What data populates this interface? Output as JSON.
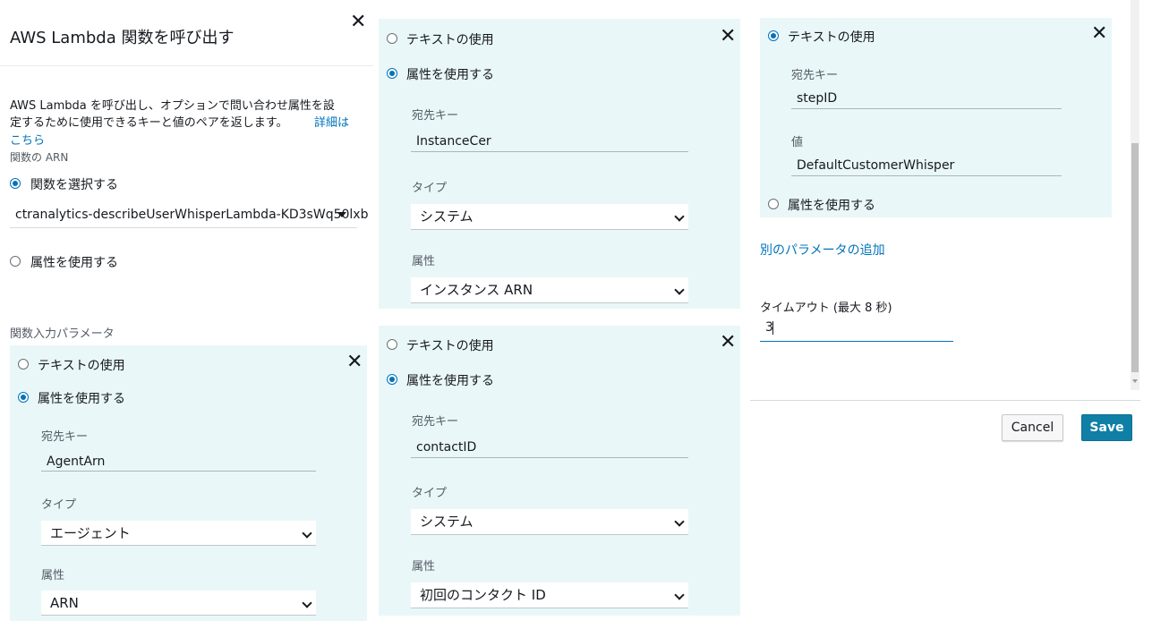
{
  "left": {
    "title": "AWS Lambda 関数を呼び出す",
    "description_line1": "AWS Lambda を呼び出し、オプションで問い合わせ属性を設",
    "description_line2": "定するために使用できるキーと値のペアを返します。",
    "learn_more_line1": "詳細は",
    "learn_more_line2": "こちら",
    "function_arn_label": "関数の ARN",
    "select_function_label": "関数を選択する",
    "function_value": "ctranalytics-describeUserWhisperLambda-KD3sWq50lxb",
    "use_attribute_label": "属性を使用する",
    "input_params_label": "関数入力パラメータ"
  },
  "panel1": {
    "use_text": "テキストの使用",
    "use_attribute": "属性を使用する",
    "dest_key_label": "宛先キー",
    "dest_key_value": "AgentArn",
    "type_label": "タイプ",
    "type_value": "エージェント",
    "attribute_label": "属性",
    "attribute_value": "ARN"
  },
  "panel2": {
    "use_text": "テキストの使用",
    "use_attribute": "属性を使用する",
    "dest_key_label": "宛先キー",
    "dest_key_value": "InstanceCer",
    "type_label": "タイプ",
    "type_value": "システム",
    "attribute_label": "属性",
    "attribute_value": "インスタンス ARN"
  },
  "panel3": {
    "use_text": "テキストの使用",
    "use_attribute": "属性を使用する",
    "dest_key_label": "宛先キー",
    "dest_key_value": "contactID",
    "type_label": "タイプ",
    "type_value": "システム",
    "attribute_label": "属性",
    "attribute_value": "初回のコンタクト ID"
  },
  "panel4": {
    "use_text": "テキストの使用",
    "dest_key_label": "宛先キー",
    "dest_key_value": "stepID",
    "value_label": "値",
    "value_value": "DefaultCustomerWhisper",
    "use_attribute": "属性を使用する"
  },
  "right": {
    "add_param_link": "別のパラメータの追加",
    "timeout_label": "タイムアウト (最大 8 秒)",
    "timeout_value": "3"
  },
  "footer": {
    "cancel_label": "Cancel",
    "save_label": "Save"
  },
  "colors": {
    "panel_bg": "#e9f7f8",
    "link": "#0073bb",
    "save_bg": "#0f7fa6"
  },
  "icons": [
    "close-icon",
    "chevron-down-icon",
    "caret-down-icon"
  ]
}
